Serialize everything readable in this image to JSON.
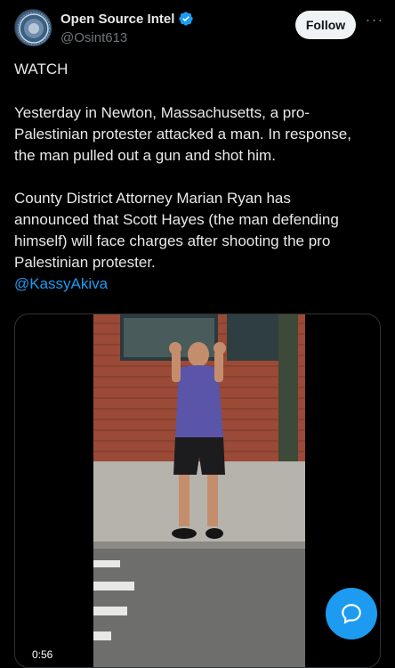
{
  "tweet": {
    "author": {
      "display_name": "Open Source Intel",
      "handle": "@Osint613",
      "verified": true,
      "avatar_icon": "seal-logo"
    },
    "follow_label": "Follow",
    "more_icon": "more-icon",
    "paragraphs": [
      "WATCH",
      "Yesterday in Newton, Massachusetts, a pro-\nPalestinian protester attacked a man. In response,\nthe man pulled out a gun and shot him.",
      "County District Attorney Marian Ryan has\nannounced that Scott Hayes (the man defending\nhimself) will face charges after shooting the pro\nPalestinian protester."
    ],
    "mention": "@KassyAkiva",
    "video": {
      "duration": "0:56"
    }
  },
  "compose_fab": {
    "icon": "compose-icon"
  },
  "colors": {
    "background": "#000000",
    "accent": "#1d9bf0",
    "text": "#e7e9ea",
    "muted": "#71767b"
  }
}
